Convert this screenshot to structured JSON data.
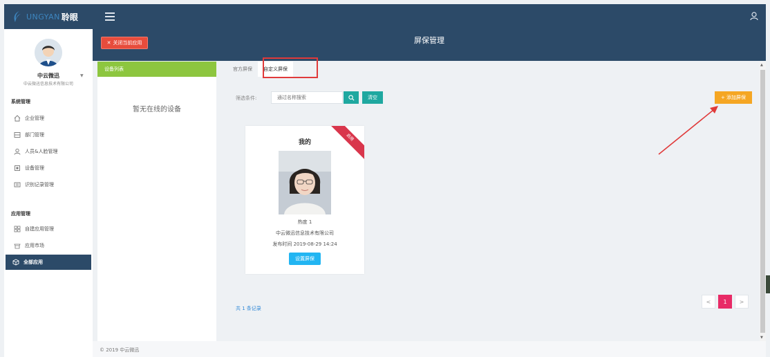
{
  "brand": {
    "en": "UNGYAN",
    "cn": "聆眼"
  },
  "sidebar": {
    "org_name": "中云微迅",
    "org_full": "中云微迅信息技术有限公司",
    "sections": [
      {
        "title": "系统管理"
      },
      {
        "title": "应用管理"
      }
    ],
    "items": [
      {
        "label": "企业管理",
        "icon": "home-icon"
      },
      {
        "label": "部门管理",
        "icon": "department-icon"
      },
      {
        "label": "人员&人脸管理",
        "icon": "person-icon"
      },
      {
        "label": "设备管理",
        "icon": "device-icon"
      },
      {
        "label": "识别记录管理",
        "icon": "record-icon"
      },
      {
        "label": "自建应用管理",
        "icon": "grid-icon"
      },
      {
        "label": "应用市场",
        "icon": "store-icon"
      },
      {
        "label": "全部应用",
        "icon": "cube-icon",
        "active": true
      }
    ]
  },
  "header": {
    "close_label": "关闭当前应用",
    "title": "屏保管理"
  },
  "device_panel": {
    "title": "设备列表",
    "empty_text": "暂无在线的设备"
  },
  "main": {
    "tabs": [
      {
        "label": "官方屏保"
      },
      {
        "label": "自定义屏保",
        "active": true
      }
    ],
    "filter_label": "筛选条件:",
    "search_placeholder": "通过名称搜索",
    "clear_label": "清空",
    "add_label": "+ 添加屏保",
    "card": {
      "ribbon": "启用",
      "title": "我的",
      "heat": "热度 1",
      "company": "中云微迅信息技术有限公司",
      "publish_time": "发布时间 2019-08-29 14:24",
      "button": "设置屏保"
    },
    "record_count": "共 1 条记录",
    "pagination": {
      "prev": "<",
      "current": "1",
      "next": ">"
    }
  },
  "footer": {
    "copyright": "© 2019 中云微迅"
  },
  "colors": {
    "header_bg": "#2c4a68",
    "close_btn": "#e74c3c",
    "device_head": "#8dc63f",
    "teal": "#1fa8a0",
    "add_btn": "#f5a623",
    "set_btn": "#22b5f2",
    "page_active": "#e82b66",
    "ribbon": "#d9364c",
    "highlight": "#e03a3a"
  }
}
